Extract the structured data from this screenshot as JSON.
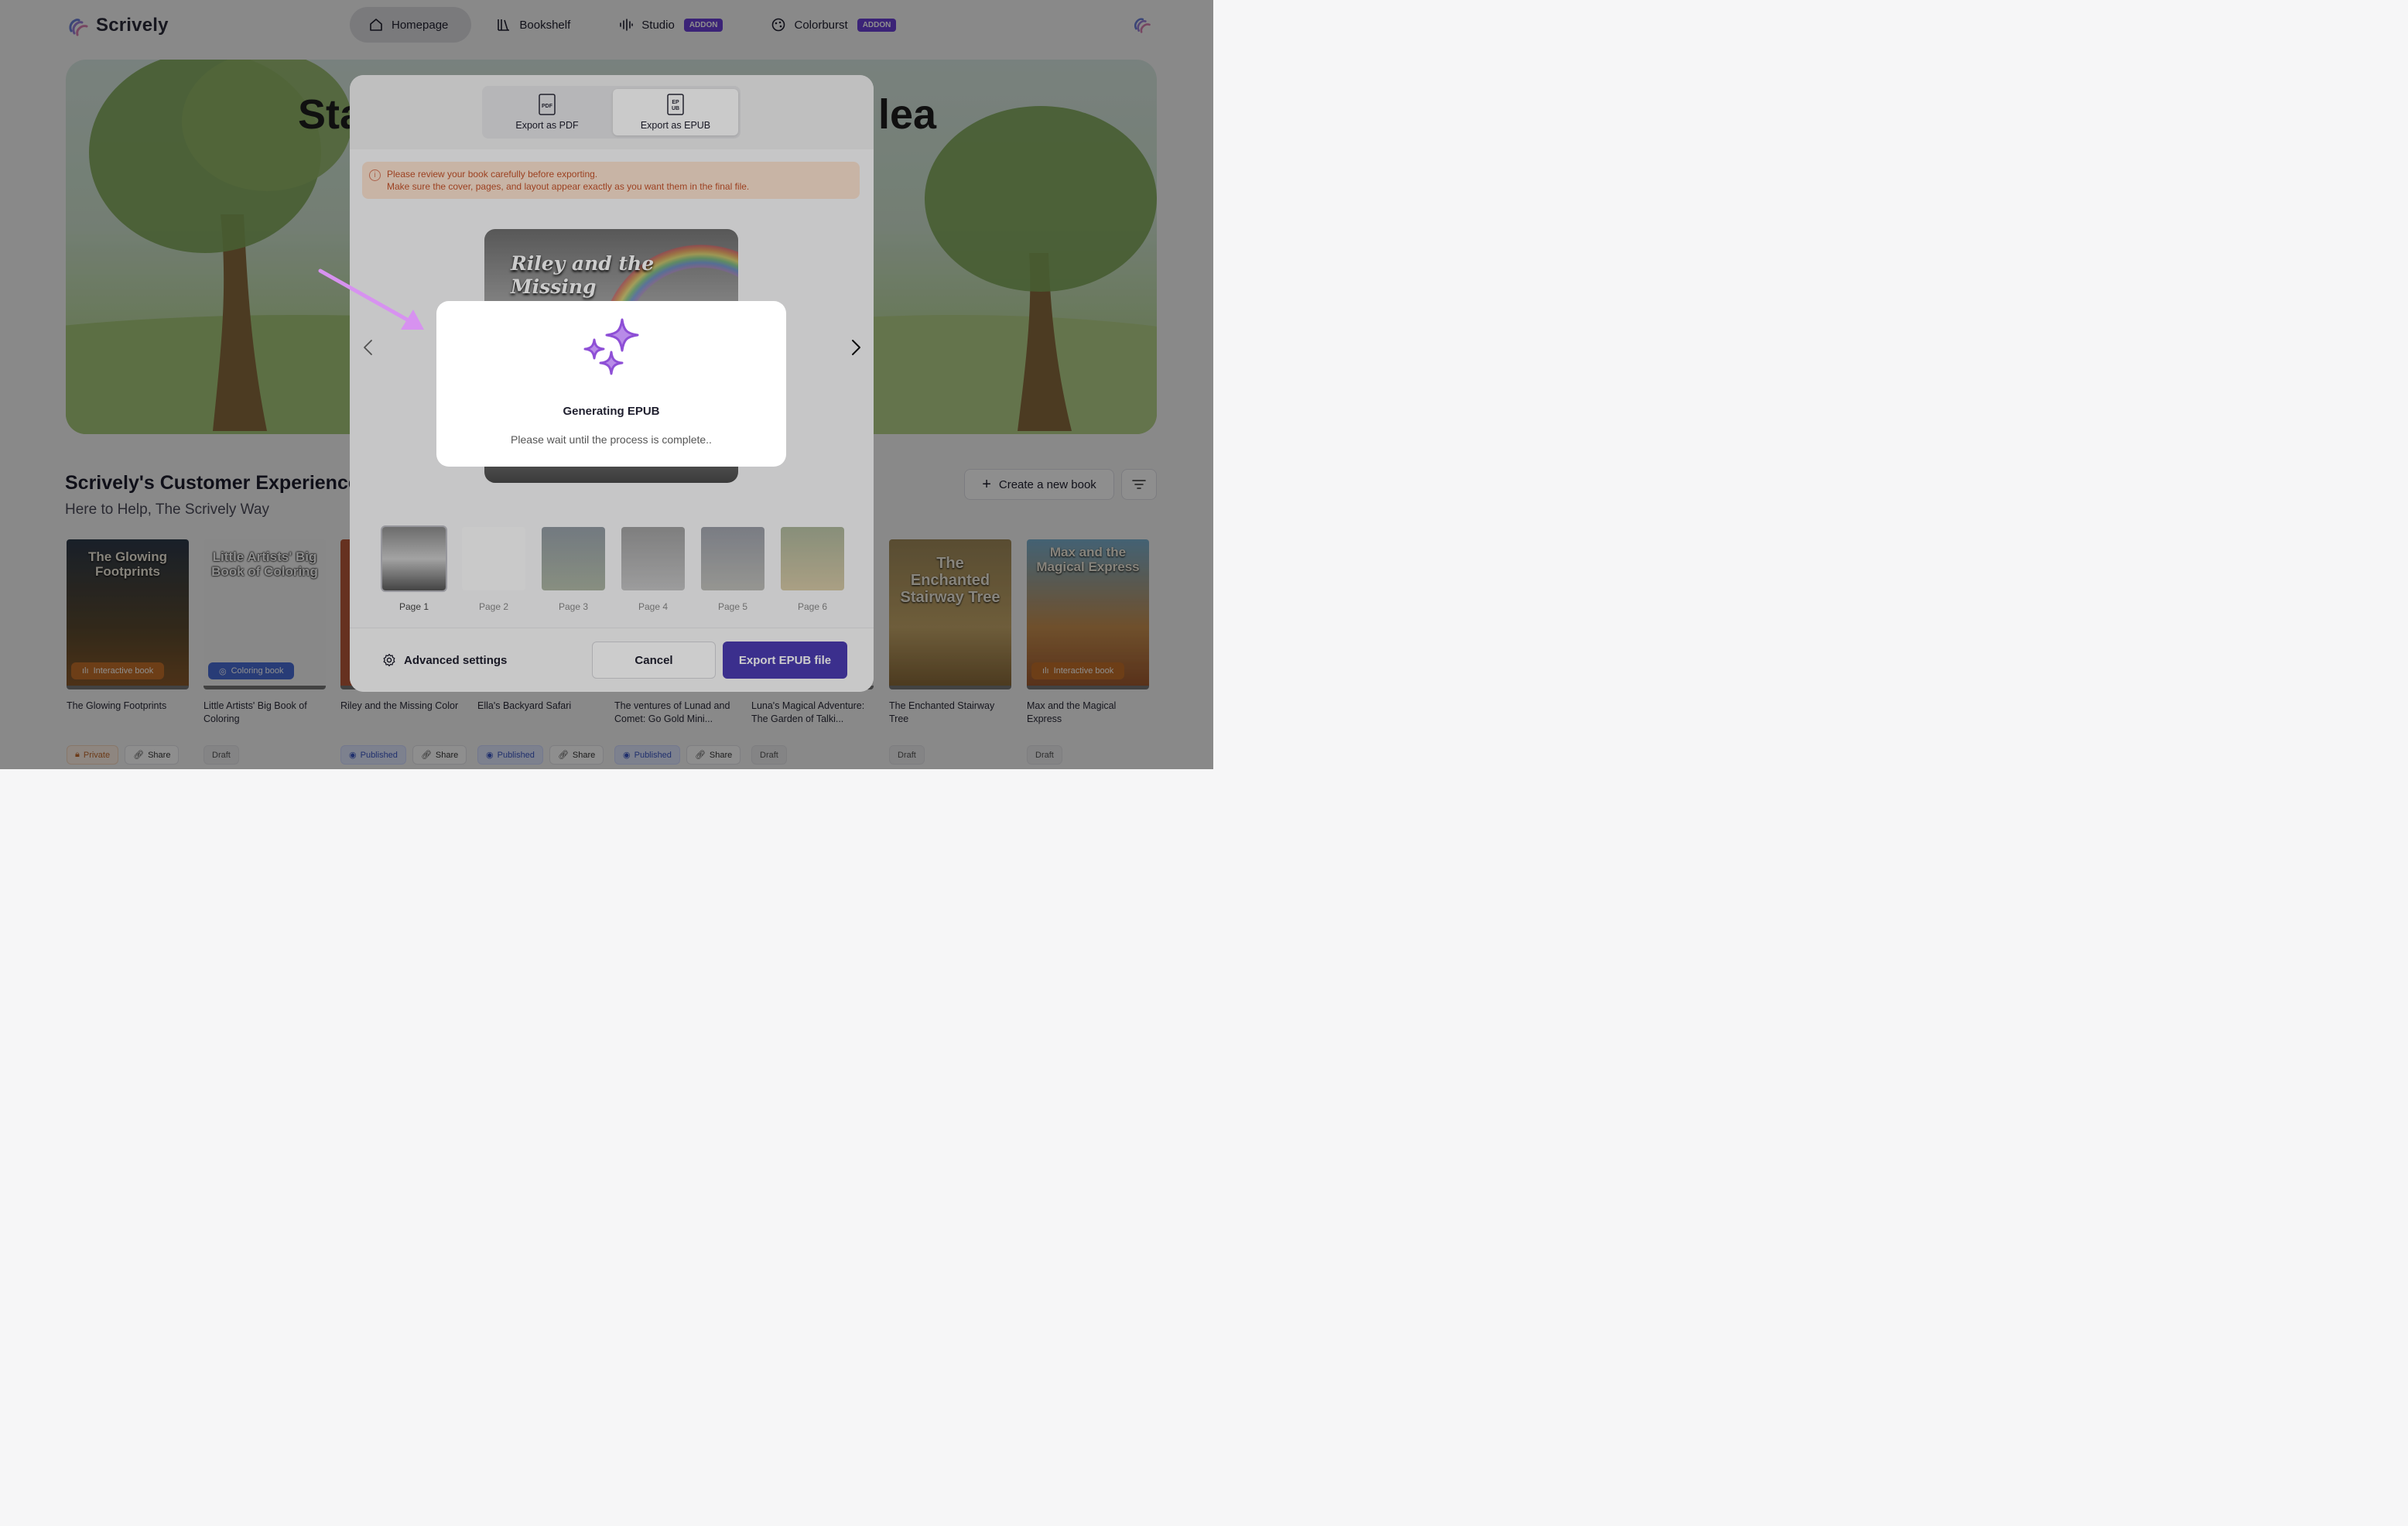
{
  "app": {
    "brand": "Scrively"
  },
  "nav": {
    "tabs": [
      {
        "label": "Homepage",
        "icon": "home-icon",
        "active": true
      },
      {
        "label": "Bookshelf",
        "icon": "books-icon"
      },
      {
        "label": "Studio",
        "icon": "audio-wave-icon",
        "badge": "ADDON"
      },
      {
        "label": "Colorburst",
        "icon": "palette-icon",
        "badge": "ADDON"
      }
    ]
  },
  "hero": {
    "title_start": "Sta",
    "title_end": "lea"
  },
  "section": {
    "title": "Scrively's Customer Experience T",
    "subtitle": "Here to Help, The Scrively Way",
    "create_label": "Create a new book"
  },
  "books": [
    {
      "title": "The Glowing Footprints",
      "cover_title": "The Glowing Footprints",
      "badge": "Interactive book",
      "tags": [
        "Private",
        "Share"
      ]
    },
    {
      "title": "Little Artists' Big Book of Coloring",
      "cover_title": "Little Artists' Big Book of Coloring",
      "badge": "Coloring book",
      "tags": [
        "Draft"
      ]
    },
    {
      "title": "Riley and the Missing Color",
      "cover_title": "",
      "badge": "",
      "tags": [
        "Published",
        "Share"
      ]
    },
    {
      "title": "Ella's Backyard Safari",
      "cover_title": "",
      "badge": "",
      "tags": [
        "Published",
        "Share"
      ]
    },
    {
      "title": "The ventures of Lunad and Comet: Go Gold Mini...",
      "cover_title": "",
      "badge": "",
      "tags": [
        "Published",
        "Share"
      ]
    },
    {
      "title": "Luna's Magical Adventure: The Garden of Talki...",
      "cover_title": "",
      "badge": "",
      "tags": [
        "Draft"
      ]
    },
    {
      "title": "The Enchanted Stairway Tree",
      "cover_title": "The Enchanted Stairway Tree",
      "badge": "",
      "tags": [
        "Draft"
      ]
    },
    {
      "title": "Max and the Magical Express",
      "cover_title": "Max and the Magical Express",
      "badge": "Interactive book",
      "tags": [
        "Draft"
      ]
    }
  ],
  "modal": {
    "export_pdf_label": "Export as PDF",
    "export_epub_label": "Export as EPUB",
    "warning_line1": "Please review your book carefully before exporting.",
    "warning_line2": "Make sure the cover, pages, and layout appear exactly as you want them in the final file.",
    "preview_title": "Riley and the Missing",
    "pages": [
      "Page 1",
      "Page 2",
      "Page 3",
      "Page 4",
      "Page 5",
      "Page 6"
    ],
    "advanced_label": "Advanced settings",
    "cancel_label": "Cancel",
    "export_label": "Export EPUB file"
  },
  "generating": {
    "title": "Generating EPUB",
    "message": "Please wait until the process is complete.."
  },
  "colors": {
    "accent": "#4a3bb1",
    "addon": "#6b3fd6",
    "sparkle": "#8e4fd6",
    "warning_bg": "#fbe2cf",
    "warning_text": "#c4522a"
  }
}
